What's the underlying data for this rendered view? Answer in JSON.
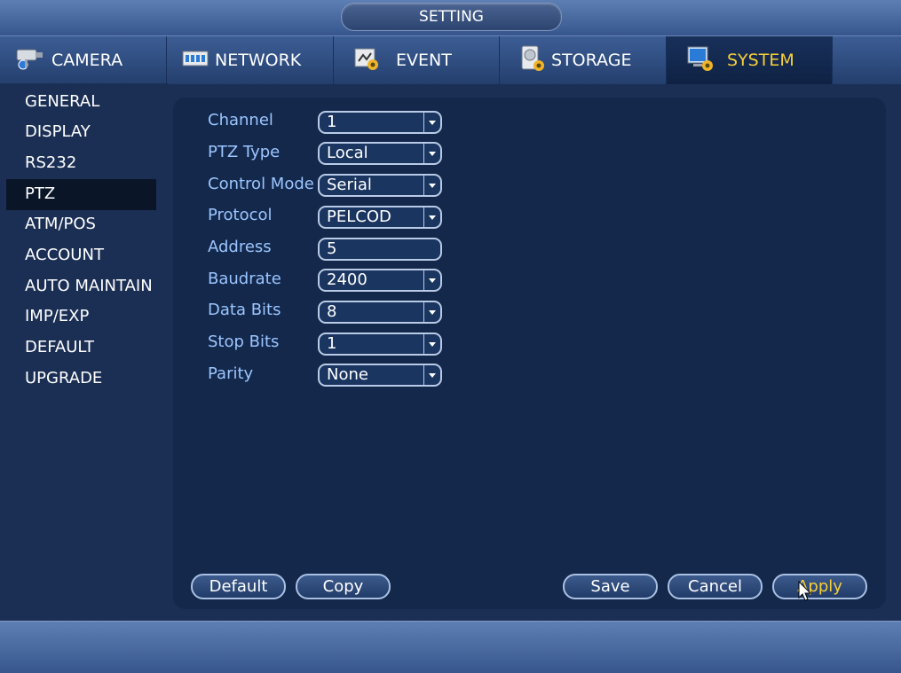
{
  "window": {
    "title": "SETTING"
  },
  "tabs": [
    {
      "label": "CAMERA",
      "icon": "camera-icon"
    },
    {
      "label": "NETWORK",
      "icon": "network-icon"
    },
    {
      "label": "EVENT",
      "icon": "event-icon"
    },
    {
      "label": "STORAGE",
      "icon": "storage-icon"
    },
    {
      "label": "SYSTEM",
      "icon": "system-icon",
      "active": true
    }
  ],
  "sidebar": {
    "items": [
      "GENERAL",
      "DISPLAY",
      "RS232",
      "PTZ",
      "ATM/POS",
      "ACCOUNT",
      "AUTO MAINTAIN",
      "IMP/EXP",
      "DEFAULT",
      "UPGRADE"
    ],
    "active": "PTZ"
  },
  "form": {
    "channel": {
      "label": "Channel",
      "value": "1"
    },
    "ptz_type": {
      "label": "PTZ Type",
      "value": "Local"
    },
    "control_mode": {
      "label": "Control Mode",
      "value": "Serial"
    },
    "protocol": {
      "label": "Protocol",
      "value": "PELCOD"
    },
    "address": {
      "label": "Address",
      "value": "5"
    },
    "baudrate": {
      "label": "Baudrate",
      "value": "2400"
    },
    "data_bits": {
      "label": "Data Bits",
      "value": "8"
    },
    "stop_bits": {
      "label": "Stop Bits",
      "value": "1"
    },
    "parity": {
      "label": "Parity",
      "value": "None"
    }
  },
  "buttons": {
    "default": "Default",
    "copy": "Copy",
    "save": "Save",
    "cancel": "Cancel",
    "apply": "Apply"
  },
  "colors": {
    "accent": "#f7cf3a",
    "label": "#9cc5ff",
    "panel": "#13284b"
  }
}
